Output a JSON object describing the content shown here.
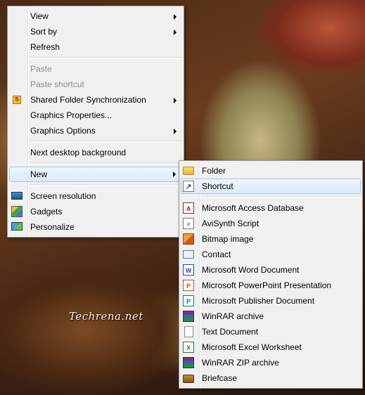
{
  "wallpaper": {
    "watermark": "Techrena.net"
  },
  "context_menu": {
    "view": "View",
    "sort_by": "Sort by",
    "refresh": "Refresh",
    "paste": "Paste",
    "paste_shortcut": "Paste shortcut",
    "shared_folder_sync": "Shared Folder Synchronization",
    "graphics_properties": "Graphics Properties...",
    "graphics_options": "Graphics Options",
    "next_background": "Next desktop background",
    "new": "New",
    "screen_resolution": "Screen resolution",
    "gadgets": "Gadgets",
    "personalize": "Personalize"
  },
  "new_submenu": {
    "folder": "Folder",
    "shortcut": "Shortcut",
    "access": "Microsoft Access Database",
    "avisynth": "AviSynth Script",
    "bitmap": "Bitmap image",
    "contact": "Contact",
    "word": "Microsoft Word Document",
    "powerpoint": "Microsoft PowerPoint Presentation",
    "publisher": "Microsoft Publisher Document",
    "winrar": "WinRAR archive",
    "text": "Text Document",
    "excel": "Microsoft Excel Worksheet",
    "winrar_zip": "WinRAR ZIP archive",
    "briefcase": "Briefcase"
  }
}
